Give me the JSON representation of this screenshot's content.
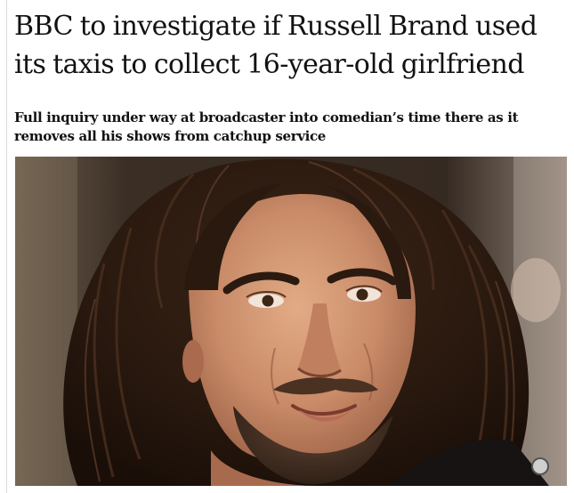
{
  "article": {
    "headline": "BBC to investigate if Russell Brand used its taxis to collect 16-year-old girlfriend",
    "standfirst": "Full inquiry under way at broadcaster into comedian’s time there as it removes all his shows from catchup service"
  },
  "colors": {
    "text": "#121212",
    "background": "#ffffff",
    "rule": "#dcdcdc"
  }
}
